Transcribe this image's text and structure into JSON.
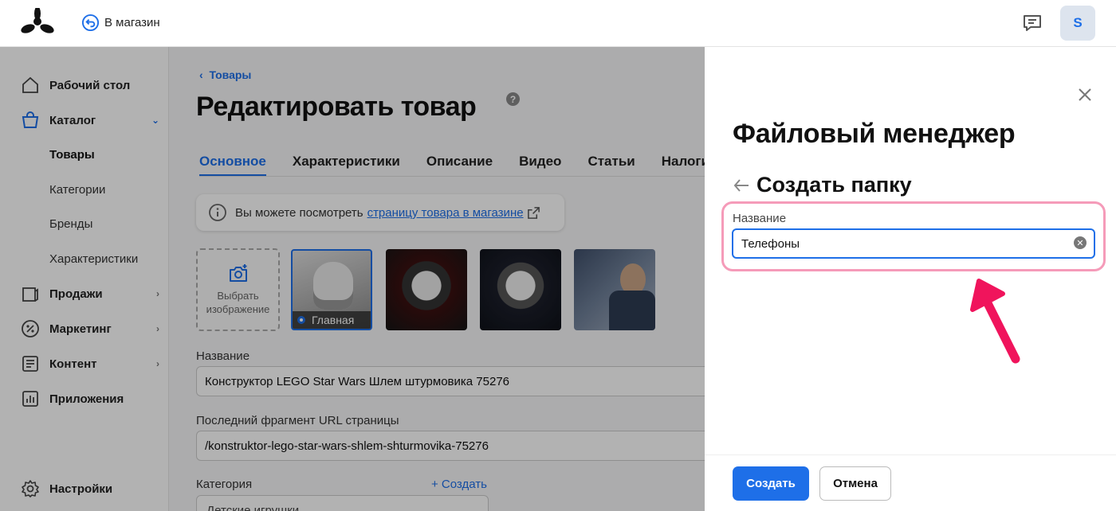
{
  "topbar": {
    "back_store_label": "В магазин",
    "avatar_letter": "S"
  },
  "sidebar": {
    "items": [
      {
        "label": "Рабочий стол",
        "icon": "home-icon"
      },
      {
        "label": "Каталог",
        "icon": "bag-icon",
        "expanded": true
      },
      {
        "label": "Продажи",
        "icon": "sales-icon"
      },
      {
        "label": "Маркетинг",
        "icon": "percent-icon"
      },
      {
        "label": "Контент",
        "icon": "content-icon"
      },
      {
        "label": "Приложения",
        "icon": "apps-icon"
      },
      {
        "label": "Настройки",
        "icon": "gear-icon"
      }
    ],
    "catalog_sub": [
      "Товары",
      "Категории",
      "Бренды",
      "Характеристики"
    ],
    "active_sub": "Товары"
  },
  "main": {
    "breadcrumb": "Товары",
    "title": "Редактировать товар",
    "tabs": [
      "Основное",
      "Характеристики",
      "Описание",
      "Видео",
      "Статьи",
      "Налоги"
    ],
    "active_tab": "Основное",
    "info_text": "Вы можете посмотреть",
    "info_link": "страницу товара в магазине",
    "upload_label_1": "Выбрать",
    "upload_label_2": "изображение",
    "main_badge": "Главная",
    "name_label": "Название",
    "name_value": "Конструктор LEGO Star Wars Шлем штурмовика 75276",
    "url_label": "Последний фрагмент URL страницы",
    "url_value": "/konstruktor-lego-star-wars-shlem-shturmovika-75276",
    "category_label": "Категория",
    "create_link": "+ Создать",
    "category_value": "Детские игрушки"
  },
  "panel": {
    "title": "Файловый менеджер",
    "subtitle": "Создать папку",
    "field_label": "Название",
    "field_value": "Телефоны",
    "create_button": "Создать",
    "cancel_button": "Отмена",
    "accent_color": "#1e6fe8",
    "highlight_color": "#f59bb9",
    "arrow_color": "#f0145c"
  }
}
